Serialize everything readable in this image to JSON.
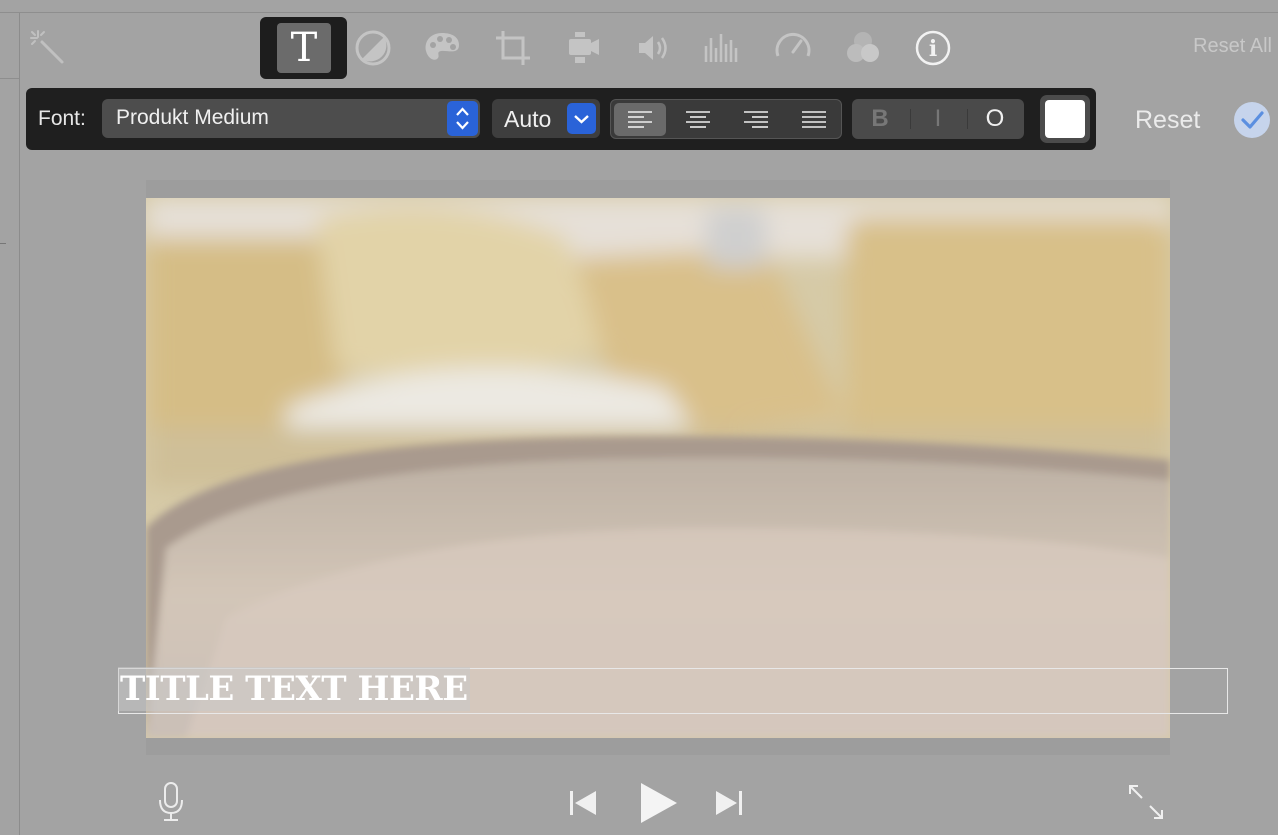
{
  "toolbar": {
    "reset_all_label": "Reset All",
    "icons": [
      "magic-wand-icon",
      "title-text-icon",
      "color-balance-icon",
      "color-palette-icon",
      "crop-icon",
      "stabilization-camera-icon",
      "volume-icon",
      "equalizer-icon",
      "speedometer-icon",
      "overlay-circles-icon",
      "info-icon"
    ],
    "title_glyph": "T",
    "info_glyph": "i"
  },
  "inspector": {
    "font_label": "Font:",
    "font_value": "Produkt Medium",
    "size_value": "Auto",
    "alignment": {
      "options": [
        "left",
        "center",
        "right",
        "justify"
      ],
      "selected": "left"
    },
    "style_buttons": {
      "bold": "B",
      "italic": "I",
      "outline": "O"
    },
    "text_color": "#ffffff",
    "accent_color": "#2a63d8"
  },
  "actions": {
    "reset_label": "Reset",
    "apply_icon": "checkmark-icon"
  },
  "viewer": {
    "title_text": "TITLE TEXT HERE"
  },
  "playback": {
    "icons": [
      "microphone-icon",
      "skip-back-icon",
      "play-icon",
      "skip-forward-icon",
      "fullscreen-icon"
    ]
  }
}
